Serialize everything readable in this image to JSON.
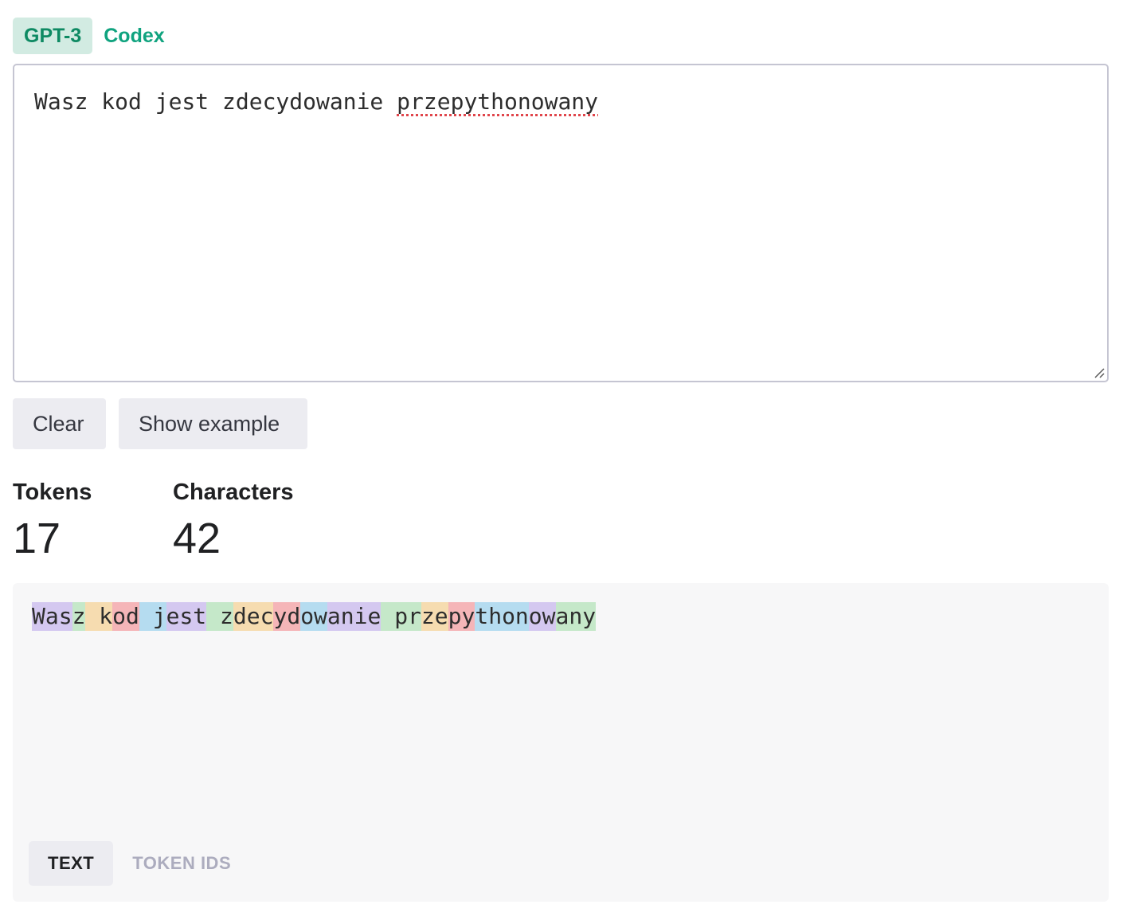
{
  "model_tabs": [
    {
      "label": "GPT-3",
      "active": true
    },
    {
      "label": "Codex",
      "active": false
    }
  ],
  "editor": {
    "text_plain": "Wasz kod jest zdecydowanie ",
    "text_misspelled": "przepythonowany"
  },
  "buttons": {
    "clear_label": "Clear",
    "example_label": "Show example"
  },
  "stats": {
    "tokens_label": "Tokens",
    "tokens_value": "17",
    "characters_label": "Characters",
    "characters_value": "42"
  },
  "token_colors": [
    "#d4c8f0",
    "#c5e8c9",
    "#f6dcb0",
    "#f5b5b8",
    "#b5dcf0"
  ],
  "tokens": [
    {
      "text": "Was",
      "color": 0
    },
    {
      "text": "z",
      "color": 1
    },
    {
      "text": " k",
      "color": 2
    },
    {
      "text": "od",
      "color": 3
    },
    {
      "text": " j",
      "color": 4
    },
    {
      "text": "est",
      "color": 0
    },
    {
      "text": " z",
      "color": 1
    },
    {
      "text": "dec",
      "color": 2
    },
    {
      "text": "yd",
      "color": 3
    },
    {
      "text": "ow",
      "color": 4
    },
    {
      "text": "anie",
      "color": 0
    },
    {
      "text": " pr",
      "color": 1
    },
    {
      "text": "ze",
      "color": 2
    },
    {
      "text": "py",
      "color": 3
    },
    {
      "text": "thon",
      "color": 4
    },
    {
      "text": "ow",
      "color": 0
    },
    {
      "text": "any",
      "color": 1
    }
  ],
  "view_tabs": {
    "text_label": "TEXT",
    "ids_label": "TOKEN IDS"
  }
}
